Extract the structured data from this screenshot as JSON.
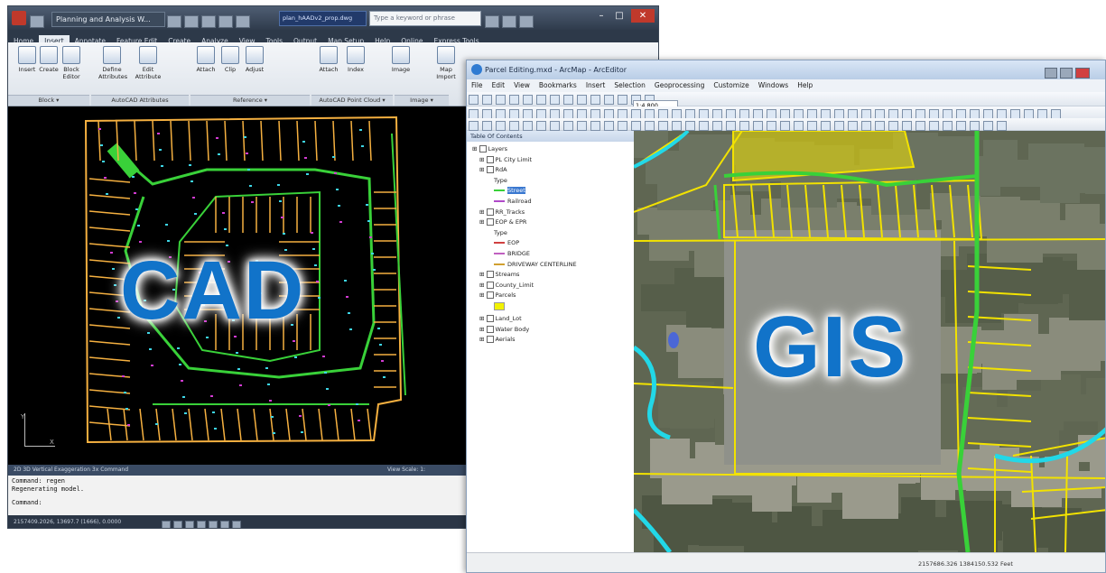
{
  "cad": {
    "title": "Planning and Analysis W...",
    "doc_tab": "plan_hAADv2_prop.dwg",
    "search_placeholder": "Type a keyword or phrase",
    "tabs": [
      "Home",
      "Insert",
      "Annotate",
      "Feature Edit",
      "Create",
      "Analyze",
      "View",
      "Tools",
      "Output",
      "Map Setup",
      "Help",
      "Online",
      "Express Tools"
    ],
    "active_tab": "Insert",
    "tools": [
      "Insert",
      "Create",
      "Block Editor",
      "Define Attributes",
      "Edit Attribute",
      "Attach",
      "Clip",
      "Adjust",
      "Attach",
      "Index",
      "Image",
      "Map Import"
    ],
    "panels": [
      "Block ▾",
      "AutoCAD Attributes",
      "Reference ▾",
      "AutoCAD Point Cloud ▾",
      "Image ▾"
    ],
    "status_left": "2D  3D  Vertical Exaggeration  3x  Command",
    "view_scale": "View Scale: 1:",
    "command_lines": [
      "Command: regen",
      "Regenerating model.",
      "Command:"
    ],
    "coords": "2157409.2026, 13697.7 (1666), 0.0000",
    "big_label": "CAD"
  },
  "gis": {
    "title": "Parcel Editing.mxd - ArcMap - ArcEditor",
    "menu": [
      "File",
      "Edit",
      "View",
      "Bookmarks",
      "Insert",
      "Selection",
      "Geoprocessing",
      "Customize",
      "Windows",
      "Help"
    ],
    "scale": "1:4,800",
    "toc_title": "Table Of Contents",
    "layers": [
      {
        "label": "Layers",
        "indent": 0,
        "kind": "group"
      },
      {
        "label": "PL City Limit",
        "indent": 1,
        "kind": "layer"
      },
      {
        "label": "RdA",
        "indent": 1,
        "kind": "layer"
      },
      {
        "label": "Type",
        "indent": 3,
        "kind": "text"
      },
      {
        "label": "Street",
        "indent": 3,
        "kind": "sym",
        "color": "#39d139",
        "selected": true
      },
      {
        "label": "Railroad",
        "indent": 3,
        "kind": "sym",
        "color": "#b04ac9"
      },
      {
        "label": "RR_Tracks",
        "indent": 1,
        "kind": "layer"
      },
      {
        "label": "EOP & EPR",
        "indent": 1,
        "kind": "layer"
      },
      {
        "label": "Type",
        "indent": 3,
        "kind": "text"
      },
      {
        "label": "EOP",
        "indent": 3,
        "kind": "sym",
        "color": "#d04040"
      },
      {
        "label": "BRIDGE",
        "indent": 3,
        "kind": "sym",
        "color": "#c060c0"
      },
      {
        "label": "DRIVEWAY CENTERLINE",
        "indent": 3,
        "kind": "sym",
        "color": "#d1a030"
      },
      {
        "label": "Streams",
        "indent": 1,
        "kind": "layer"
      },
      {
        "label": "County_Limit",
        "indent": 1,
        "kind": "layer"
      },
      {
        "label": "Parcels",
        "indent": 1,
        "kind": "layer"
      },
      {
        "label": "",
        "indent": 3,
        "kind": "swatch",
        "color": "#f2f200"
      },
      {
        "label": "Land_Lot",
        "indent": 1,
        "kind": "layer"
      },
      {
        "label": "Water Body",
        "indent": 1,
        "kind": "layer"
      },
      {
        "label": "Aerials",
        "indent": 1,
        "kind": "layer"
      }
    ],
    "status": "2157686.326  1384150.532 Feet",
    "big_label": "GIS"
  },
  "colors": {
    "label_blue": "#1173c9",
    "parcel_yellow": "#f2e200",
    "road_green": "#39d139",
    "water_cyan": "#22d8e8",
    "cad_lot": "#f5b040"
  }
}
